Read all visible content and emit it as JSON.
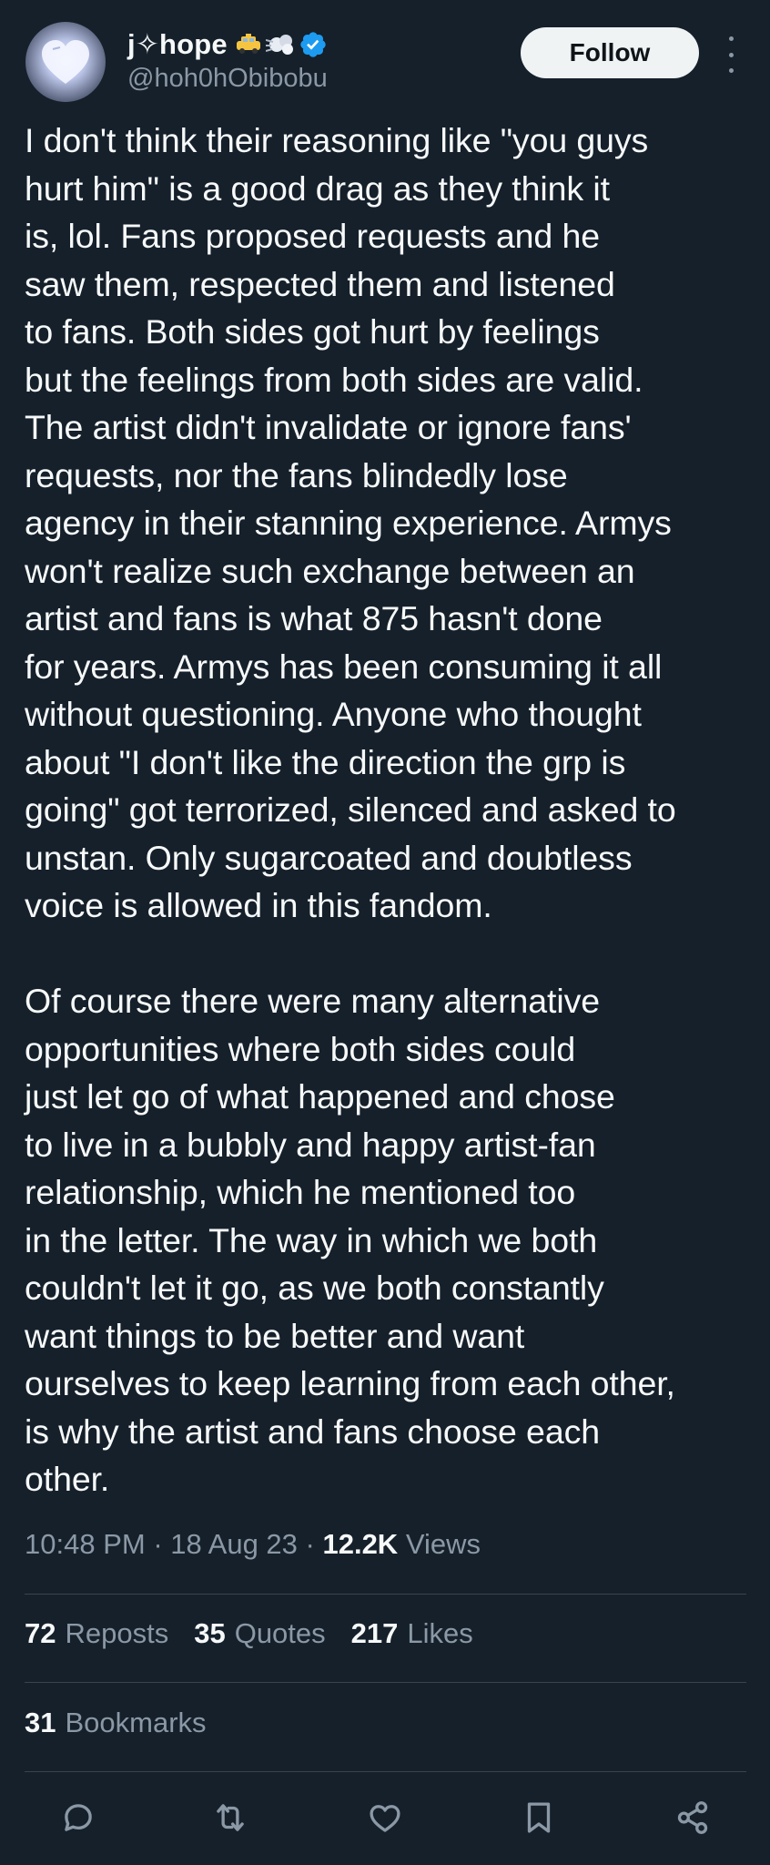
{
  "author": {
    "display_name": "j✧hope",
    "handle": "@hoh0hObibobu",
    "verified": true,
    "avatar_icon": "heart-icon"
  },
  "header": {
    "follow_label": "Follow",
    "more_icon": "more-vertical-icon"
  },
  "tweet": {
    "text": "I don't think their reasoning like \"you guys\nhurt him\" is a good drag as they think it\nis, lol. Fans proposed requests and he\nsaw them, respected them and listened\nto fans. Both sides got hurt by feelings\nbut the feelings from both sides are valid.\nThe artist didn't invalidate or ignore fans'\nrequests, nor the fans blindedly lose\nagency in their stanning experience. Armys\nwon't realize such exchange between an\nartist and fans is what 875 hasn't done\nfor years. Armys has been consuming it all\nwithout questioning. Anyone who thought\nabout \"I don't like the direction the grp is\ngoing\" got terrorized, silenced and asked to\nunstan. Only sugarcoated and doubtless\nvoice is allowed in this fandom.\n\nOf course there were many alternative\nopportunities where both sides could\njust let go of what happened and chose\nto live in a bubbly and happy artist-fan\nrelationship, which he mentioned too\nin the letter. The way in which we both\ncouldn't let it go, as we both constantly\nwant things to be better and want\nourselves to keep learning from each other,\nis why the artist and fans choose each\nother."
  },
  "meta": {
    "time": "10:48 PM",
    "sep1": " · ",
    "date": "18 Aug 23",
    "sep2": " · ",
    "views_count": "12.2K",
    "views_label": "Views"
  },
  "stats": {
    "reposts_count": "72",
    "reposts_label": "Reposts",
    "quotes_count": "35",
    "quotes_label": "Quotes",
    "likes_count": "217",
    "likes_label": "Likes",
    "bookmarks_count": "31",
    "bookmarks_label": "Bookmarks"
  },
  "actions": [
    {
      "icon": "reply-icon"
    },
    {
      "icon": "repost-icon"
    },
    {
      "icon": "like-icon"
    },
    {
      "icon": "bookmark-icon"
    },
    {
      "icon": "share-icon"
    }
  ],
  "colors": {
    "background": "#15202b",
    "text": "#f7f9f9",
    "muted": "#8b98a5",
    "verified": "#1d9bf0",
    "divider": "#38444d"
  }
}
